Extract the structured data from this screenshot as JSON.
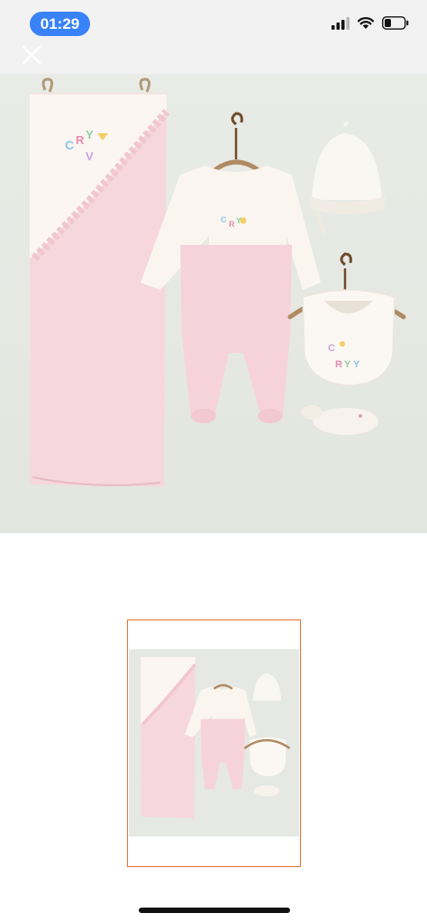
{
  "status_bar": {
    "time": "01:29",
    "signal_icon": "cellular-signal-icon",
    "wifi_icon": "wifi-icon",
    "battery_icon": "battery-icon",
    "accent_color": "#3a82f7"
  },
  "top_bar": {
    "close_icon": "close-icon"
  },
  "main_image": {
    "embroidery_text": "CRYY"
  },
  "thumbnail": {
    "border_color": "#e96f2d",
    "selected": true
  }
}
